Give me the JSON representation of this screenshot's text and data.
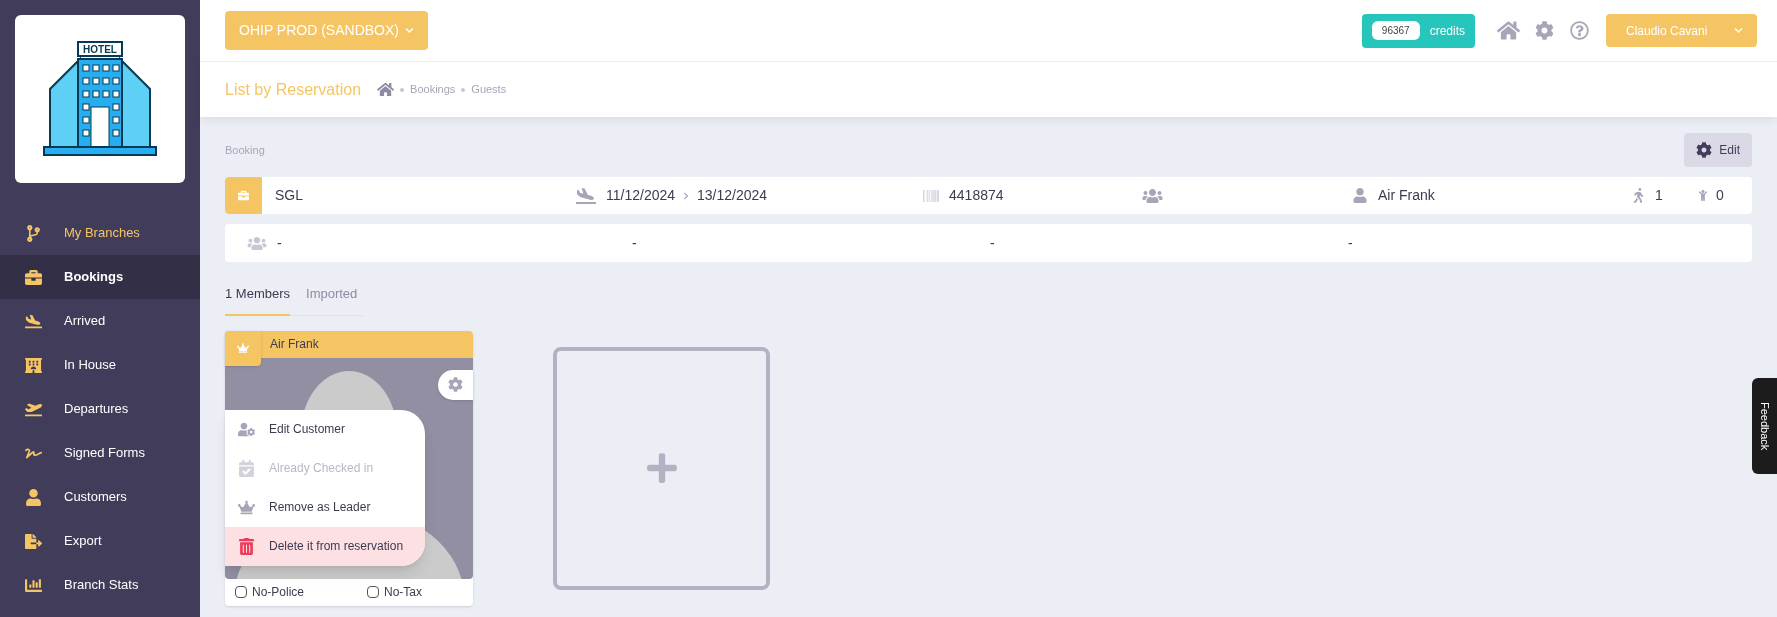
{
  "logo": {
    "sign": "HOTEL"
  },
  "sidebar": {
    "items": [
      {
        "label": "My Branches",
        "selected": false,
        "highlighted": true
      },
      {
        "label": "Bookings",
        "selected": true,
        "highlighted": false
      },
      {
        "label": "Arrived",
        "selected": false,
        "highlighted": false
      },
      {
        "label": "In House",
        "selected": false,
        "highlighted": false
      },
      {
        "label": "Departures",
        "selected": false,
        "highlighted": false
      },
      {
        "label": "Signed Forms",
        "selected": false,
        "highlighted": false
      },
      {
        "label": "Customers",
        "selected": false,
        "highlighted": false
      },
      {
        "label": "Export",
        "selected": false,
        "highlighted": false
      },
      {
        "label": "Branch Stats",
        "selected": false,
        "highlighted": false
      }
    ]
  },
  "topbar": {
    "environment": "OHIP PROD (SANDBOX)",
    "credits_value": "96367",
    "credits_label": "credits",
    "user": "Claudio Cavani"
  },
  "page": {
    "title": "List by Reservation",
    "breadcrumbs": [
      "Bookings",
      "Guests"
    ]
  },
  "booking": {
    "label": "Booking",
    "edit_button": "Edit",
    "room_type": "SGL",
    "arrival": "11/12/2024",
    "departure": "13/12/2024",
    "number": "4418874",
    "guest": "Air Frank",
    "adults": "1",
    "children": "0",
    "details": [
      "-",
      "-",
      "-",
      "-"
    ]
  },
  "tabs": [
    {
      "label": "1 Members",
      "selected": true
    },
    {
      "label": "Imported",
      "selected": false
    }
  ],
  "member": {
    "name": "Air Frank",
    "leader": true,
    "menu": [
      {
        "kind": "edit",
        "label": "Edit Customer",
        "disabled": false,
        "highlighted": false
      },
      {
        "kind": "checkin",
        "label": "Already Checked in",
        "disabled": true,
        "highlighted": false
      },
      {
        "kind": "leader",
        "label": "Remove as Leader",
        "disabled": false,
        "highlighted": false
      },
      {
        "kind": "delete",
        "label": "Delete it from reservation",
        "disabled": false,
        "highlighted": true
      }
    ],
    "options": [
      {
        "label": "No-Police",
        "checked": false
      },
      {
        "label": "No-Tax",
        "checked": false
      }
    ]
  },
  "feedback": "Feedback"
}
